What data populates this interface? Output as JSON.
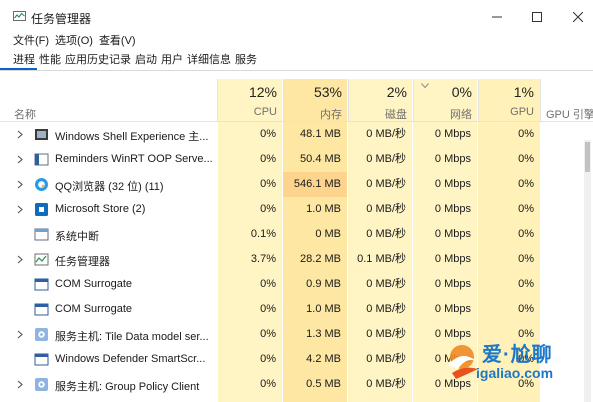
{
  "window": {
    "title": "任务管理器"
  },
  "menu": [
    "文件(F)",
    "选项(O)",
    "查看(V)"
  ],
  "tabs": [
    "进程",
    "性能",
    "应用历史记录",
    "启动",
    "用户",
    "详细信息",
    "服务"
  ],
  "columns": {
    "name": "名称",
    "cpu": {
      "pct": "12%",
      "label": "CPU"
    },
    "mem": {
      "pct": "53%",
      "label": "内存"
    },
    "disk": {
      "pct": "2%",
      "label": "磁盘"
    },
    "net": {
      "pct": "0%",
      "label": "网络"
    },
    "gpu": {
      "pct": "1%",
      "label": "GPU"
    },
    "gpu_engine": "GPU 引擎"
  },
  "rows": [
    {
      "name": "Windows Shell Experience 主...",
      "cpu": "0%",
      "mem": "48.1 MB",
      "disk": "0 MB/秒",
      "net": "0 Mbps",
      "gpu": "0%",
      "expand": true,
      "icon": "shell-icon"
    },
    {
      "name": "Reminders WinRT OOP Serve...",
      "cpu": "0%",
      "mem": "50.4 MB",
      "disk": "0 MB/秒",
      "net": "0 Mbps",
      "gpu": "0%",
      "expand": true,
      "icon": "reminders-icon"
    },
    {
      "name": "QQ浏览器 (32 位) (11)",
      "cpu": "0%",
      "mem": "546.1 MB",
      "disk": "0 MB/秒",
      "net": "0 Mbps",
      "gpu": "0%",
      "expand": true,
      "icon": "qq-browser-icon"
    },
    {
      "name": "Microsoft Store (2)",
      "cpu": "0%",
      "mem": "1.0 MB",
      "disk": "0 MB/秒",
      "net": "0 Mbps",
      "gpu": "0%",
      "expand": true,
      "icon": "store-icon"
    },
    {
      "name": "系统中断",
      "cpu": "0.1%",
      "mem": "0 MB",
      "disk": "0 MB/秒",
      "net": "0 Mbps",
      "gpu": "0%",
      "expand": false,
      "icon": "system-interrupt-icon"
    },
    {
      "name": "任务管理器",
      "cpu": "3.7%",
      "mem": "28.2 MB",
      "disk": "0.1 MB/秒",
      "net": "0 Mbps",
      "gpu": "0%",
      "expand": true,
      "icon": "task-manager-icon"
    },
    {
      "name": "COM Surrogate",
      "cpu": "0%",
      "mem": "0.9 MB",
      "disk": "0 MB/秒",
      "net": "0 Mbps",
      "gpu": "0%",
      "expand": false,
      "icon": "com-surrogate-icon"
    },
    {
      "name": "COM Surrogate",
      "cpu": "0%",
      "mem": "1.0 MB",
      "disk": "0 MB/秒",
      "net": "0 Mbps",
      "gpu": "0%",
      "expand": false,
      "icon": "com-surrogate-icon"
    },
    {
      "name": "服务主机: Tile Data model ser...",
      "cpu": "0%",
      "mem": "1.3 MB",
      "disk": "0 MB/秒",
      "net": "0 Mbps",
      "gpu": "0%",
      "expand": true,
      "icon": "service-host-icon"
    },
    {
      "name": "Windows Defender SmartScr...",
      "cpu": "0%",
      "mem": "4.2 MB",
      "disk": "0 MB/秒",
      "net": "0 Mbps",
      "gpu": "0%",
      "expand": false,
      "icon": "defender-icon"
    },
    {
      "name": "服务主机: Group Policy Client",
      "cpu": "0%",
      "mem": "0.5 MB",
      "disk": "0 MB/秒",
      "net": "0 Mbps",
      "gpu": "0%",
      "expand": true,
      "icon": "service-host-icon"
    }
  ],
  "watermark": {
    "title": "爱·尬聊",
    "url": "igaliao.com"
  },
  "colors": {
    "usage_light": "#fff4c4",
    "usage_light2": "#fff1b8",
    "usage_mid": "#fde7a2",
    "usage_high": "#fcd48e",
    "accent": "#0a64c8"
  }
}
